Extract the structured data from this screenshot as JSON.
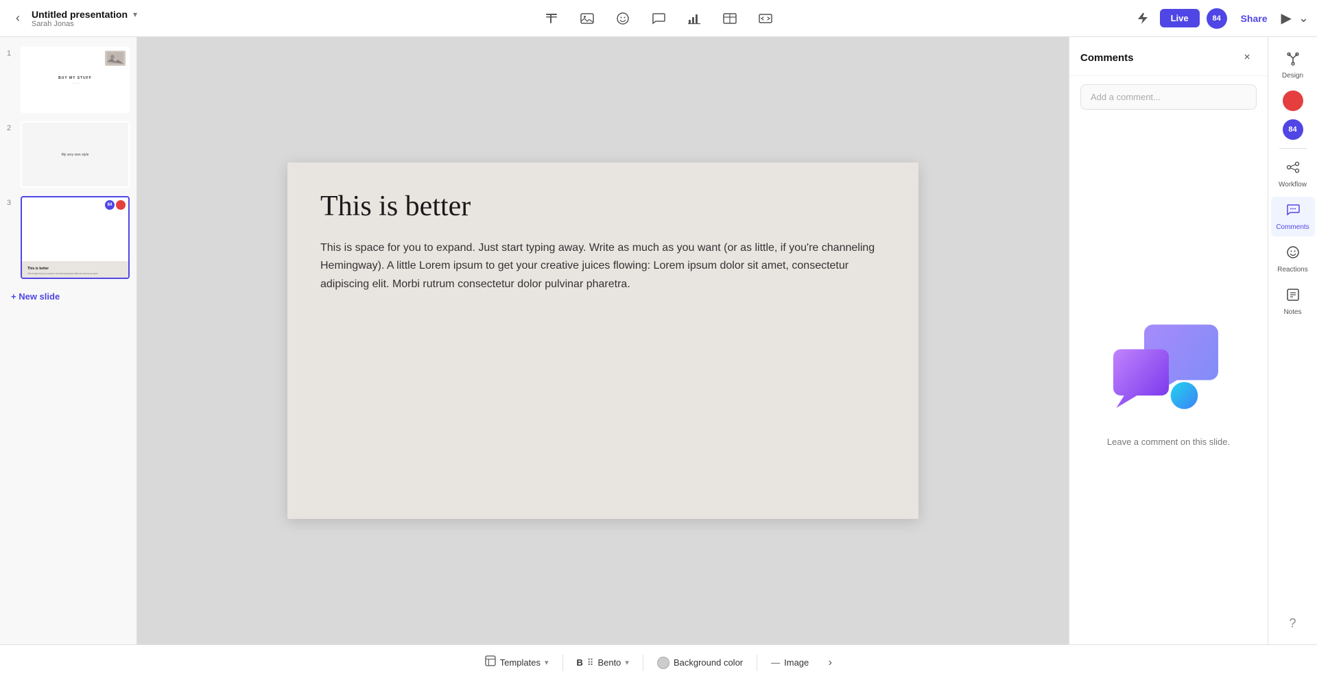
{
  "topbar": {
    "title": "Untitled presentation",
    "user": "Sarah Jonas",
    "back_label": "‹",
    "caret": "▾",
    "live_label": "Live",
    "share_label": "Share",
    "avatar_label": "84"
  },
  "toolbar_icons": [
    {
      "name": "text-icon",
      "symbol": "⊞"
    },
    {
      "name": "image-toolbar-icon",
      "symbol": "🖼"
    },
    {
      "name": "emoji-icon",
      "symbol": "☺"
    },
    {
      "name": "comment-toolbar-icon",
      "symbol": "💬"
    },
    {
      "name": "chart-icon",
      "symbol": "📊"
    },
    {
      "name": "table-icon",
      "symbol": "⊞"
    },
    {
      "name": "embed-icon",
      "symbol": "◫"
    }
  ],
  "slides": [
    {
      "num": "1",
      "type": "thumb1",
      "active": false
    },
    {
      "num": "2",
      "type": "thumb2",
      "active": false,
      "text": "My very own style"
    },
    {
      "num": "3",
      "type": "thumb3",
      "active": true,
      "title": "This is better",
      "body": "This is space for you to expand..."
    }
  ],
  "new_slide_label": "+ New slide",
  "canvas": {
    "title": "This is better",
    "body": "This is space for you to expand. Just start typing away. Write as much as you want (or as little, if you're channeling Hemingway). A little Lorem ipsum to get your creative juices flowing: Lorem ipsum dolor sit amet, consectetur adipiscing elit. Morbi rutrum consectetur dolor pulvinar pharetra."
  },
  "comments_panel": {
    "title": "Comments",
    "input_placeholder": "Add a comment...",
    "empty_text": "Leave a comment on this slide.",
    "close_label": "×"
  },
  "right_sidebar": {
    "design_label": "Design",
    "workflow_label": "Workflow",
    "comments_label": "Comments",
    "reactions_label": "Reactions",
    "notes_label": "Notes",
    "avatar_label": "84"
  },
  "bottom_bar": {
    "templates_label": "Templates",
    "bento_label": "Bento",
    "background_label": "Background color",
    "image_label": "Image"
  }
}
